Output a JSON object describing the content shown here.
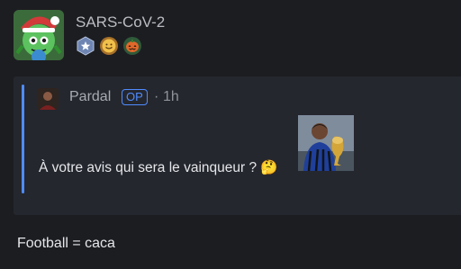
{
  "post": {
    "username": "SARS-CoV-2",
    "badges": [
      {
        "icon": "star-badge-icon",
        "color": "#8fa4c9"
      },
      {
        "icon": "smiley-badge-icon",
        "color": "#d9a94a"
      },
      {
        "icon": "pumpkin-badge-icon",
        "color": "#c9542a"
      }
    ]
  },
  "quote": {
    "author": "Pardal",
    "op_label": "OP",
    "separator": "·",
    "time": "1h",
    "text": "À votre avis qui sera le vainqueur ? 🤔",
    "accent": "#4f8cff"
  },
  "reply": {
    "text": "Football = caca"
  }
}
